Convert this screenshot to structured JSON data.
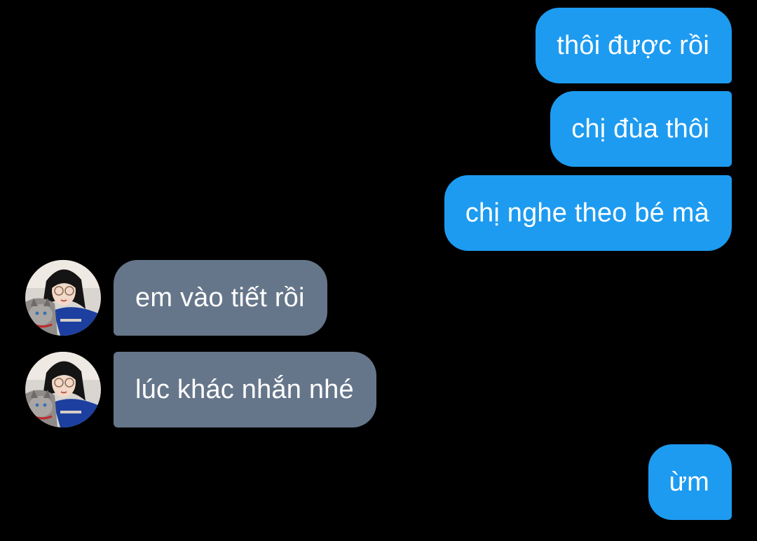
{
  "messages": [
    {
      "from": "me",
      "text": "thôi được rồi"
    },
    {
      "from": "me",
      "text": "chị đùa thôi"
    },
    {
      "from": "me",
      "text": "chị nghe theo bé mà"
    },
    {
      "from": "them",
      "text": "em vào tiết rồi"
    },
    {
      "from": "them",
      "text": "lúc khác nhắn nhé"
    },
    {
      "from": "me",
      "text": "ừm"
    }
  ],
  "colors": {
    "background": "#000000",
    "sent_bubble": "#1d9bf0",
    "received_bubble": "#66768a",
    "text": "#ffffff"
  },
  "icons": {
    "avatar": "contact-avatar-photo"
  }
}
